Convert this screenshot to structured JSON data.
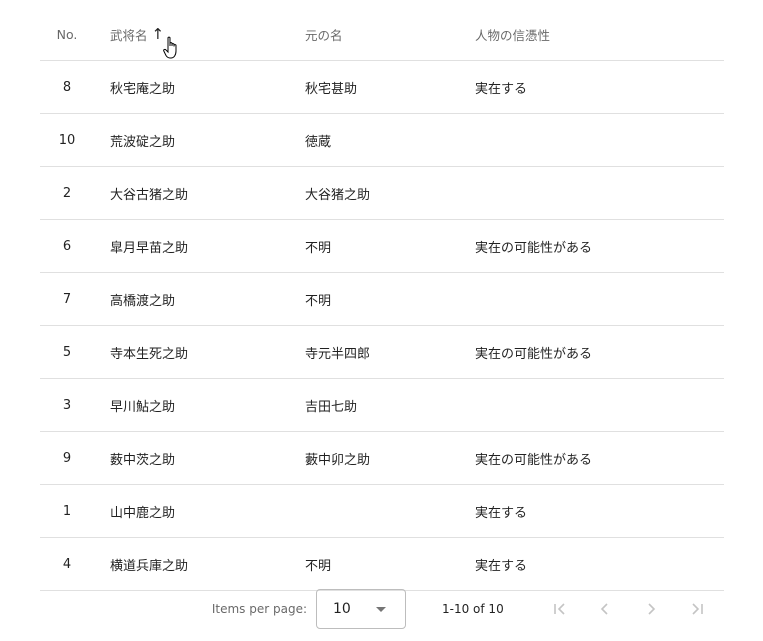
{
  "table": {
    "headers": {
      "no": "No.",
      "name": "武将名",
      "original": "元の名",
      "credibility": "人物の信憑性"
    },
    "sort": {
      "column": "name",
      "direction": "ascending",
      "icon": "arrow-up-icon"
    },
    "rows": [
      {
        "no": "8",
        "name": "秋宅庵之助",
        "original": "秋宅甚助",
        "credibility": "実在する"
      },
      {
        "no": "10",
        "name": "荒波碇之助",
        "original": "徳蔵",
        "credibility": ""
      },
      {
        "no": "2",
        "name": "大谷古猪之助",
        "original": "大谷猪之助",
        "credibility": ""
      },
      {
        "no": "6",
        "name": "皐月早苗之助",
        "original": "不明",
        "credibility": "実在の可能性がある"
      },
      {
        "no": "7",
        "name": "高橋渡之助",
        "original": "不明",
        "credibility": ""
      },
      {
        "no": "5",
        "name": "寺本生死之助",
        "original": "寺元半四郎",
        "credibility": "実在の可能性がある"
      },
      {
        "no": "3",
        "name": "早川鮎之助",
        "original": "吉田七助",
        "credibility": ""
      },
      {
        "no": "9",
        "name": "薮中茨之助",
        "original": "藪中卯之助",
        "credibility": "実在の可能性がある"
      },
      {
        "no": "1",
        "name": "山中鹿之助",
        "original": "",
        "credibility": "実在する"
      },
      {
        "no": "4",
        "name": "横道兵庫之助",
        "original": "不明",
        "credibility": "実在する"
      }
    ]
  },
  "paginator": {
    "items_per_page_label": "Items per page:",
    "page_size": "10",
    "range_label": "1-10 of 10"
  }
}
